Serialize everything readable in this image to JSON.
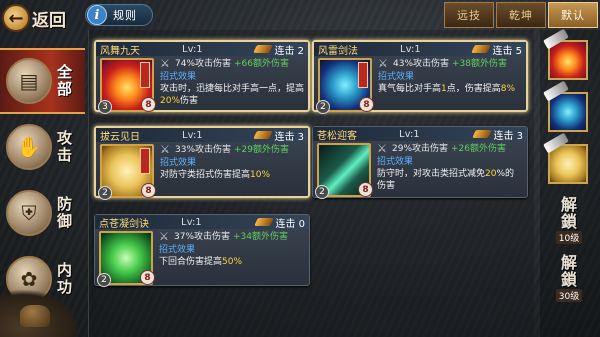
{
  "header": {
    "back_icon": "back-arrow-icon",
    "back_label": "返回",
    "rules_icon": "info-i-icon",
    "rules_label": "规则",
    "sort_buttons": [
      {
        "label": "远技",
        "active": false
      },
      {
        "label": "乾坤",
        "active": false
      },
      {
        "label": "默认",
        "active": true
      }
    ]
  },
  "tabs": [
    {
      "label": "全部",
      "icon": "scroll-icon",
      "active": true
    },
    {
      "label": "攻击",
      "icon": "fist-icon",
      "active": false
    },
    {
      "label": "防御",
      "icon": "shield-icon",
      "active": false
    },
    {
      "label": "内功",
      "icon": "swirl-icon",
      "active": false
    }
  ],
  "cards": [
    {
      "name": "风舞九天",
      "level": "Lv:1",
      "combo": "连击 2",
      "pct": "74%攻击伤害",
      "bonus": "+66额外伤害",
      "effect_title": "招式效果",
      "desc_a": "攻击时，迅捷每比对手高一点，提高",
      "desc_hl": "20%",
      "desc_b": "伤害",
      "count": "3",
      "rank": "8",
      "art": "phoenix",
      "selected": true
    },
    {
      "name": "风雷剑法",
      "level": "Lv:1",
      "combo": "连击 5",
      "pct": "43%攻击伤害",
      "bonus": "+38额外伤害",
      "effect_title": "招式效果",
      "desc_a": "真气每比对手高",
      "desc_hl": "1",
      "desc_b": "点，伤害提高",
      "desc_hl2": "8%",
      "count": "2",
      "rank": "8",
      "art": "storm",
      "selected": true
    },
    {
      "name": "拔云见日",
      "level": "Lv:1",
      "combo": "连击 3",
      "pct": "33%攻击伤害",
      "bonus": "+29额外伤害",
      "effect_title": "招式效果",
      "desc_a": "对防守类招式伤害提高",
      "desc_hl": "10%",
      "desc_b": "",
      "count": "2",
      "rank": "8",
      "art": "cloud",
      "selected": true
    },
    {
      "name": "苍松迎客",
      "level": "Lv:1",
      "combo": "连击 3",
      "pct": "29%攻击伤害",
      "bonus": "+26额外伤害",
      "effect_title": "招式效果",
      "desc_a": "防守时，对攻击类招式减免",
      "desc_hl": "20",
      "desc_b": "%的伤害",
      "count": "2",
      "rank": "8",
      "art": "pine",
      "selected": false
    },
    {
      "name": "点苍凝剑诀",
      "level": "Lv:1",
      "combo": "连击 0",
      "pct": "37%攻击伤害",
      "bonus": "+34额外伤害",
      "effect_title": "招式效果",
      "desc_a": "下回合伤害提高",
      "desc_hl": "50%",
      "desc_b": "",
      "count": "2",
      "rank": "8",
      "art": "jade",
      "selected": false
    }
  ],
  "equipped_slots": [
    {
      "art": "phoenix",
      "icon": "phoenix-skill-icon"
    },
    {
      "art": "storm",
      "icon": "storm-skill-icon"
    },
    {
      "art": "cloud",
      "icon": "cloud-skill-icon"
    }
  ],
  "locked_slots": [
    {
      "label_top": "解",
      "label_bottom": "鎖",
      "level": "10级"
    },
    {
      "label_top": "解",
      "label_bottom": "鎖",
      "level": "30级"
    }
  ]
}
